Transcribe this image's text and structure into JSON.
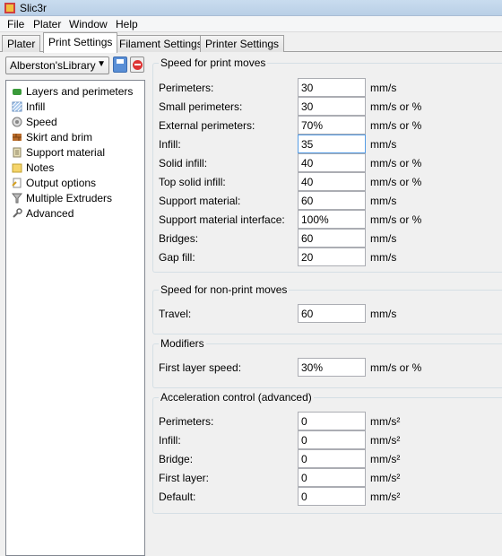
{
  "window": {
    "title": "Slic3r"
  },
  "menu": [
    "File",
    "Plater",
    "Window",
    "Help"
  ],
  "tabs": [
    "Plater",
    "Print Settings",
    "Filament Settings",
    "Printer Settings"
  ],
  "active_tab": "Print Settings",
  "preset": {
    "selected": "Alberston'sLibrary"
  },
  "tree": [
    {
      "label": "Layers and perimeters",
      "icon": "layers-icon"
    },
    {
      "label": "Infill",
      "icon": "infill-icon"
    },
    {
      "label": "Speed",
      "icon": "speed-icon"
    },
    {
      "label": "Skirt and brim",
      "icon": "skirt-icon"
    },
    {
      "label": "Support material",
      "icon": "support-icon"
    },
    {
      "label": "Notes",
      "icon": "notes-icon"
    },
    {
      "label": "Output options",
      "icon": "output-icon"
    },
    {
      "label": "Multiple Extruders",
      "icon": "extruder-icon"
    },
    {
      "label": "Advanced",
      "icon": "wrench-icon"
    }
  ],
  "groups": {
    "print_moves": {
      "title": "Speed for print moves",
      "rows": [
        {
          "label": "Perimeters:",
          "value": "30",
          "unit": "mm/s"
        },
        {
          "label": "Small perimeters:",
          "value": "30",
          "unit": "mm/s or %"
        },
        {
          "label": "External perimeters:",
          "value": "70%",
          "unit": "mm/s or %"
        },
        {
          "label": "Infill:",
          "value": "35",
          "unit": "mm/s"
        },
        {
          "label": "Solid infill:",
          "value": "40",
          "unit": "mm/s or %"
        },
        {
          "label": "Top solid infill:",
          "value": "40",
          "unit": "mm/s or %"
        },
        {
          "label": "Support material:",
          "value": "60",
          "unit": "mm/s"
        },
        {
          "label": "Support material interface:",
          "value": "100%",
          "unit": "mm/s or %"
        },
        {
          "label": "Bridges:",
          "value": "60",
          "unit": "mm/s"
        },
        {
          "label": "Gap fill:",
          "value": "20",
          "unit": "mm/s"
        }
      ]
    },
    "non_print": {
      "title": "Speed for non-print moves",
      "rows": [
        {
          "label": "Travel:",
          "value": "60",
          "unit": "mm/s"
        }
      ]
    },
    "modifiers": {
      "title": "Modifiers",
      "rows": [
        {
          "label": "First layer speed:",
          "value": "30%",
          "unit": "mm/s or %"
        }
      ]
    },
    "acceleration": {
      "title": "Acceleration control (advanced)",
      "rows": [
        {
          "label": "Perimeters:",
          "value": "0",
          "unit": "mm/s²"
        },
        {
          "label": "Infill:",
          "value": "0",
          "unit": "mm/s²"
        },
        {
          "label": "Bridge:",
          "value": "0",
          "unit": "mm/s²"
        },
        {
          "label": "First layer:",
          "value": "0",
          "unit": "mm/s²"
        },
        {
          "label": "Default:",
          "value": "0",
          "unit": "mm/s²"
        }
      ]
    }
  }
}
